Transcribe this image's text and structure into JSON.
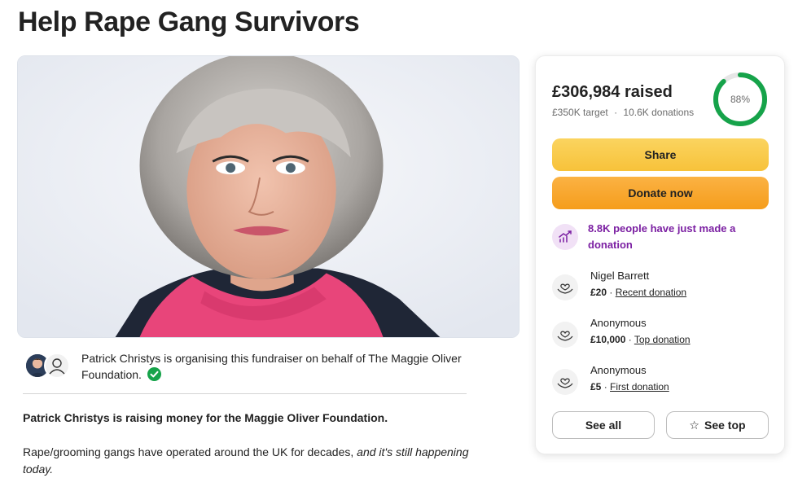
{
  "page": {
    "title": "Help Rape Gang Survivors"
  },
  "organiser": {
    "text": "Patrick Christys is organising this fundraiser on behalf of The Maggie Oliver Foundation."
  },
  "story": {
    "headline": "Patrick Christys is raising money for the Maggie Oliver Foundation.",
    "body_plain": "Rape/grooming gangs have operated around the UK for decades, ",
    "body_italic": "and it's still happening today."
  },
  "donation_card": {
    "raised": "£306,984 raised",
    "target": "£350K target",
    "separator": "·",
    "donations_count": "10.6K donations",
    "progress_label": "88%",
    "progress_fraction": 0.88,
    "share_label": "Share",
    "donate_label": "Donate now",
    "trend_text": "8.8K people have just made a donation",
    "donations": [
      {
        "name": "Nigel Barrett",
        "amount": "£20",
        "sep": " · ",
        "tag": "Recent donation"
      },
      {
        "name": "Anonymous",
        "amount": "£10,000",
        "sep": " · ",
        "tag": "Top donation"
      },
      {
        "name": "Anonymous",
        "amount": "£5",
        "sep": " · ",
        "tag": "First donation"
      }
    ],
    "see_all_label": "See all",
    "see_top_label": "See top"
  },
  "colors": {
    "progress_green": "#16a34a",
    "trend_purple": "#7b1fa2",
    "share_yellow": "#f7c23a",
    "donate_orange": "#f59d1b"
  },
  "icons": {
    "verified": "verified-check-icon",
    "trend": "trending-up-icon",
    "donation": "heart-hands-icon",
    "star": "star-icon",
    "person": "person-icon"
  }
}
